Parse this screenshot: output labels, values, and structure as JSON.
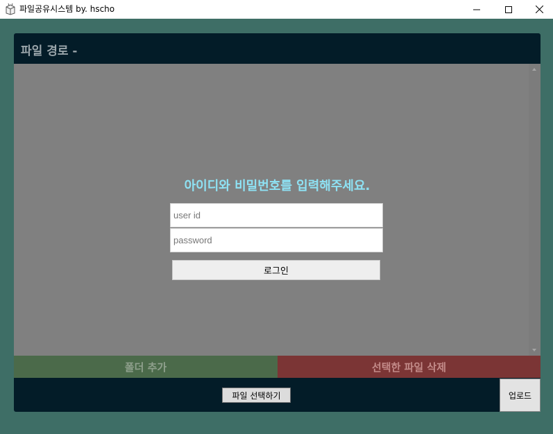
{
  "window": {
    "title": "파일공유시스템 by. hscho",
    "app_icon": "box-app-icon",
    "controls": [
      "minimize-icon",
      "maximize-icon",
      "close-icon"
    ]
  },
  "header": {
    "path_label": "파일 경로 -"
  },
  "login": {
    "prompt": "아이디와 비밀번호를 입력해주세요.",
    "user_id_placeholder": "user id",
    "user_id_value": "",
    "password_placeholder": "password",
    "password_value": "",
    "login_label": "로그인"
  },
  "actions": {
    "add_folder_label": "폴더 추가",
    "delete_selected_label": "선택한 파일 삭제"
  },
  "upload": {
    "choose_file_label": "파일 선택하기",
    "upload_label": "업로드"
  },
  "colors": {
    "background": "#3e6e66",
    "panel": "#031c28",
    "file_area": "#808080",
    "prompt": "#8ee2f4",
    "add_folder": "#4b6a4a",
    "delete": "#7b3535"
  }
}
